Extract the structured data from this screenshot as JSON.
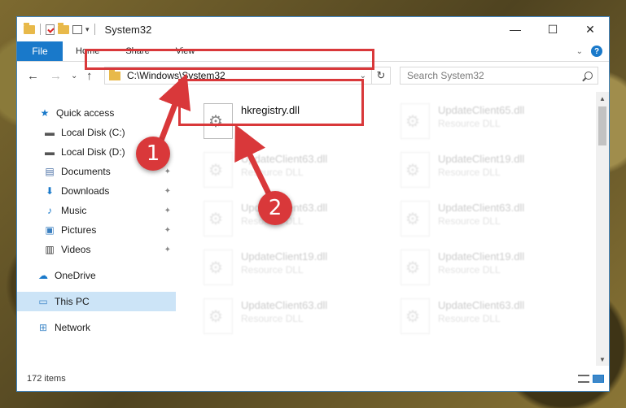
{
  "window": {
    "title": "System32",
    "minimize": "—",
    "maximize": "☐",
    "close": "✕"
  },
  "ribbon": {
    "tabs": [
      "File",
      "Home",
      "Share",
      "View"
    ],
    "collapse": "⌄",
    "help": "?"
  },
  "navigation": {
    "back": "←",
    "forward": "→",
    "recent": "⌄",
    "up": "↑",
    "address": "C:\\Windows\\System32",
    "address_dropdown": "⌄",
    "refresh": "↻",
    "search_placeholder": "Search System32"
  },
  "sidebar": {
    "items": [
      {
        "label": "Quick access",
        "icon": "star-icon",
        "glyph": "★",
        "color": "#1979ca",
        "pinned": false
      },
      {
        "label": "Local Disk (C:)",
        "icon": "drive-icon",
        "glyph": "▬",
        "color": "#555555",
        "pinned": false
      },
      {
        "label": "Local Disk (D:)",
        "icon": "drive-icon",
        "glyph": "▬",
        "color": "#555555",
        "pinned": false
      },
      {
        "label": "Documents",
        "icon": "document-icon",
        "glyph": "▤",
        "color": "#4a6fa5",
        "pinned": true
      },
      {
        "label": "Downloads",
        "icon": "download-icon",
        "glyph": "⬇",
        "color": "#1979ca",
        "pinned": true
      },
      {
        "label": "Music",
        "icon": "music-icon",
        "glyph": "♪",
        "color": "#1979ca",
        "pinned": true
      },
      {
        "label": "Pictures",
        "icon": "pictures-icon",
        "glyph": "▣",
        "color": "#3a7fc0",
        "pinned": true
      },
      {
        "label": "Videos",
        "icon": "video-icon",
        "glyph": "▥",
        "color": "#333333",
        "pinned": true
      },
      {
        "label": "OneDrive",
        "icon": "cloud-icon",
        "glyph": "☁",
        "color": "#1979ca",
        "pinned": false
      },
      {
        "label": "This PC",
        "icon": "computer-icon",
        "glyph": "▭",
        "color": "#3f87c8",
        "pinned": false,
        "selected": true
      },
      {
        "label": "Network",
        "icon": "network-icon",
        "glyph": "⊞",
        "color": "#3f87c8",
        "pinned": false
      }
    ],
    "pin_glyph": "📌"
  },
  "files": [
    {
      "name": "hkregistry.dll",
      "type": "",
      "blurred": false
    },
    {
      "name": "UpdateClient65.dll",
      "type": "Resource DLL",
      "blurred": true
    },
    {
      "name": "UpdateClient63.dll",
      "type": "Resource DLL",
      "blurred": true
    },
    {
      "name": "UpdateClient19.dll",
      "type": "Resource DLL",
      "blurred": true
    },
    {
      "name": "UpdateClient63.dll",
      "type": "Resource DLL",
      "blurred": true
    },
    {
      "name": "UpdateClient63.dll",
      "type": "Resource DLL",
      "blurred": true
    },
    {
      "name": "UpdateClient19.dll",
      "type": "Resource DLL",
      "blurred": true
    },
    {
      "name": "UpdateClient19.dll",
      "type": "Resource DLL",
      "blurred": true
    },
    {
      "name": "UpdateClient63.dll",
      "type": "Resource DLL",
      "blurred": true
    },
    {
      "name": "UpdateClient63.dll",
      "type": "Resource DLL",
      "blurred": true
    }
  ],
  "status": {
    "item_count": "172 items"
  },
  "annotations": {
    "step1": "1",
    "step2": "2",
    "color": "#d9383a"
  }
}
